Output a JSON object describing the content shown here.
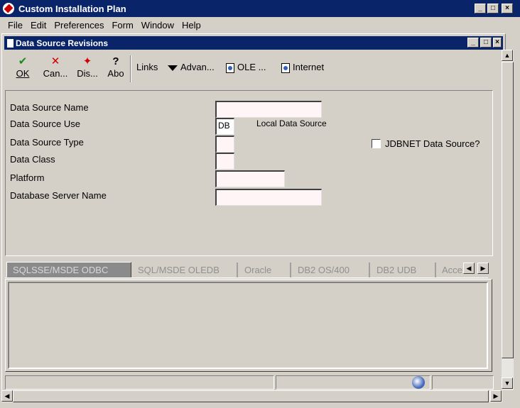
{
  "app": {
    "title": "Custom Installation Plan",
    "win_min": "_",
    "win_max": "□",
    "win_close": "×"
  },
  "menu": [
    "File",
    "Edit",
    "Preferences",
    "Form",
    "Window",
    "Help"
  ],
  "form": {
    "title": "Data Source Revisions",
    "toolbar": {
      "ok": "OK",
      "cancel": "Can...",
      "display": "Dis...",
      "about": "Abo",
      "links": "Links",
      "advanced": "Advan...",
      "ole": "OLE ...",
      "internet": "Internet"
    },
    "fields": {
      "data_source_name": {
        "label": "Data Source Name",
        "value": ""
      },
      "data_source_use": {
        "label": "Data Source Use",
        "value": "DB",
        "description": "Local Data Source"
      },
      "data_source_type": {
        "label": "Data Source Type",
        "value": ""
      },
      "data_class": {
        "label": "Data Class",
        "value": ""
      },
      "platform": {
        "label": "Platform",
        "value": ""
      },
      "database_server_name": {
        "label": "Database Server Name",
        "value": ""
      }
    },
    "jdbnet_checkbox": {
      "label": "JDBNET Data Source?",
      "checked": false
    },
    "tabs": [
      "SQLSSE/MSDE ODBC",
      "SQL/MSDE OLEDB",
      "Oracle",
      "DB2 OS/400",
      "DB2 UDB",
      "Acce"
    ],
    "active_tab": 0
  },
  "colors": {
    "titlebar": "#0a246a",
    "window_bg": "#d4d0c8",
    "field_bg": "#fff5f7"
  }
}
